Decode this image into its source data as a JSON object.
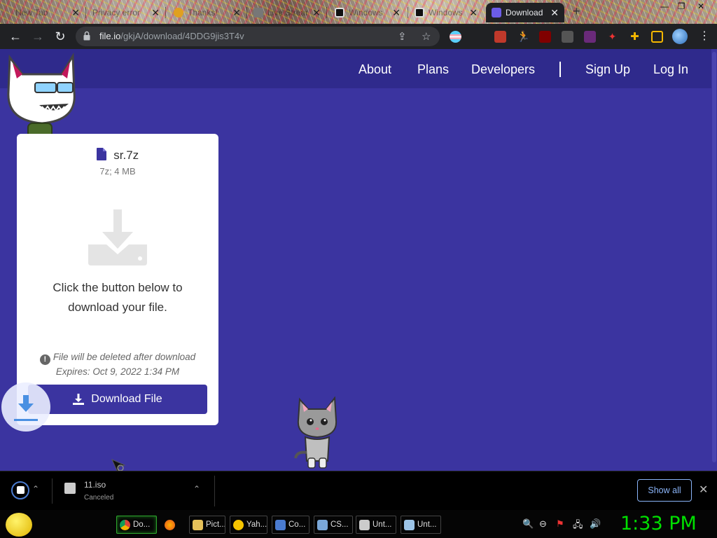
{
  "browser": {
    "tabs": [
      {
        "title": "New Tab",
        "active": false
      },
      {
        "title": "Privacy error",
        "active": false
      },
      {
        "title": "Thanks!",
        "active": false
      },
      {
        "title": "Live Stream",
        "active": false
      },
      {
        "title": "Windows",
        "active": false
      },
      {
        "title": "Windows",
        "active": false
      },
      {
        "title": "Download",
        "active": true
      }
    ],
    "new_tab_label": "+",
    "url_host": "file.io",
    "url_path": "/gkjA/download/4DDG9jis3T4v"
  },
  "site": {
    "nav": [
      "About",
      "Plans",
      "Developers",
      "Sign Up",
      "Log In"
    ]
  },
  "card": {
    "file_name": "sr.7z",
    "file_meta": "7z; 4 MB",
    "instructions": "Click the button below to download your file.",
    "notice_line1": "File will be deleted after download",
    "notice_line2": "Expires: Oct 9, 2022 1:34 PM",
    "download_button": "Download File"
  },
  "shelf": {
    "file": "11.iso",
    "status": "Canceled",
    "show_all": "Show all"
  },
  "taskbar": {
    "tasks": [
      "Do...",
      "",
      "Pict...",
      "Yah...",
      "Co...",
      "CS...",
      "Unt...",
      "Unt..."
    ],
    "clock": "1:33 PM"
  },
  "colors": {
    "page_bg": "#3b34a0",
    "header_bg": "#2f2a8c",
    "clock_green": "#00e000"
  }
}
